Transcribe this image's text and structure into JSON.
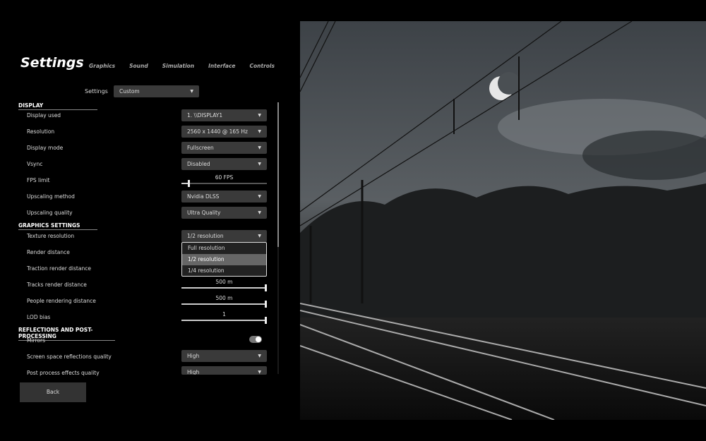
{
  "title": "Settings",
  "tabs": [
    "Graphics",
    "Sound",
    "Simulation",
    "Interface",
    "Controls"
  ],
  "preset": {
    "label": "Settings",
    "value": "Custom"
  },
  "sections": {
    "display": "DISPLAY",
    "graphics": "GRAPHICS SETTINGS",
    "reflections": "REFLECTIONS AND POST-PROCESSING"
  },
  "display": {
    "display_used": {
      "label": "Display used",
      "value": "1. \\\\DISPLAY1"
    },
    "resolution": {
      "label": "Resolution",
      "value": "2560 x 1440 @ 165 Hz"
    },
    "display_mode": {
      "label": "Display mode",
      "value": "Fullscreen"
    },
    "vsync": {
      "label": "Vsync",
      "value": "Disabled"
    },
    "fps_limit": {
      "label": "FPS limit",
      "value": "60 FPS",
      "fraction": 0.1
    },
    "upscaling_method": {
      "label": "Upscaling method",
      "value": "Nvidia DLSS"
    },
    "upscaling_quality": {
      "label": "Upscaling quality",
      "value": "Ultra Quality"
    }
  },
  "graphics": {
    "texture_resolution": {
      "label": "Texture resolution",
      "value": "1/2 resolution",
      "options": [
        "Full resolution",
        "1/2 resolution",
        "1/4 resolution"
      ]
    },
    "render_distance": {
      "label": "Render distance"
    },
    "traction_render_distance": {
      "label": "Traction render distance"
    },
    "tracks_render_distance": {
      "label": "Tracks render distance",
      "value": "500 m",
      "fraction": 1
    },
    "people_rendering_distance": {
      "label": "People rendering distance",
      "value": "500 m",
      "fraction": 1
    },
    "lod_bias": {
      "label": "LOD bias",
      "value": "1",
      "fraction": 1
    }
  },
  "reflections": {
    "mirrors": {
      "label": "Mirrors",
      "enabled": true
    },
    "ssr_quality": {
      "label": "Screen space reflections quality",
      "value": "High"
    },
    "post_process_quality": {
      "label": "Post process effects quality",
      "value": "High"
    }
  },
  "back_label": "Back",
  "dropdown_arrow": "▼"
}
